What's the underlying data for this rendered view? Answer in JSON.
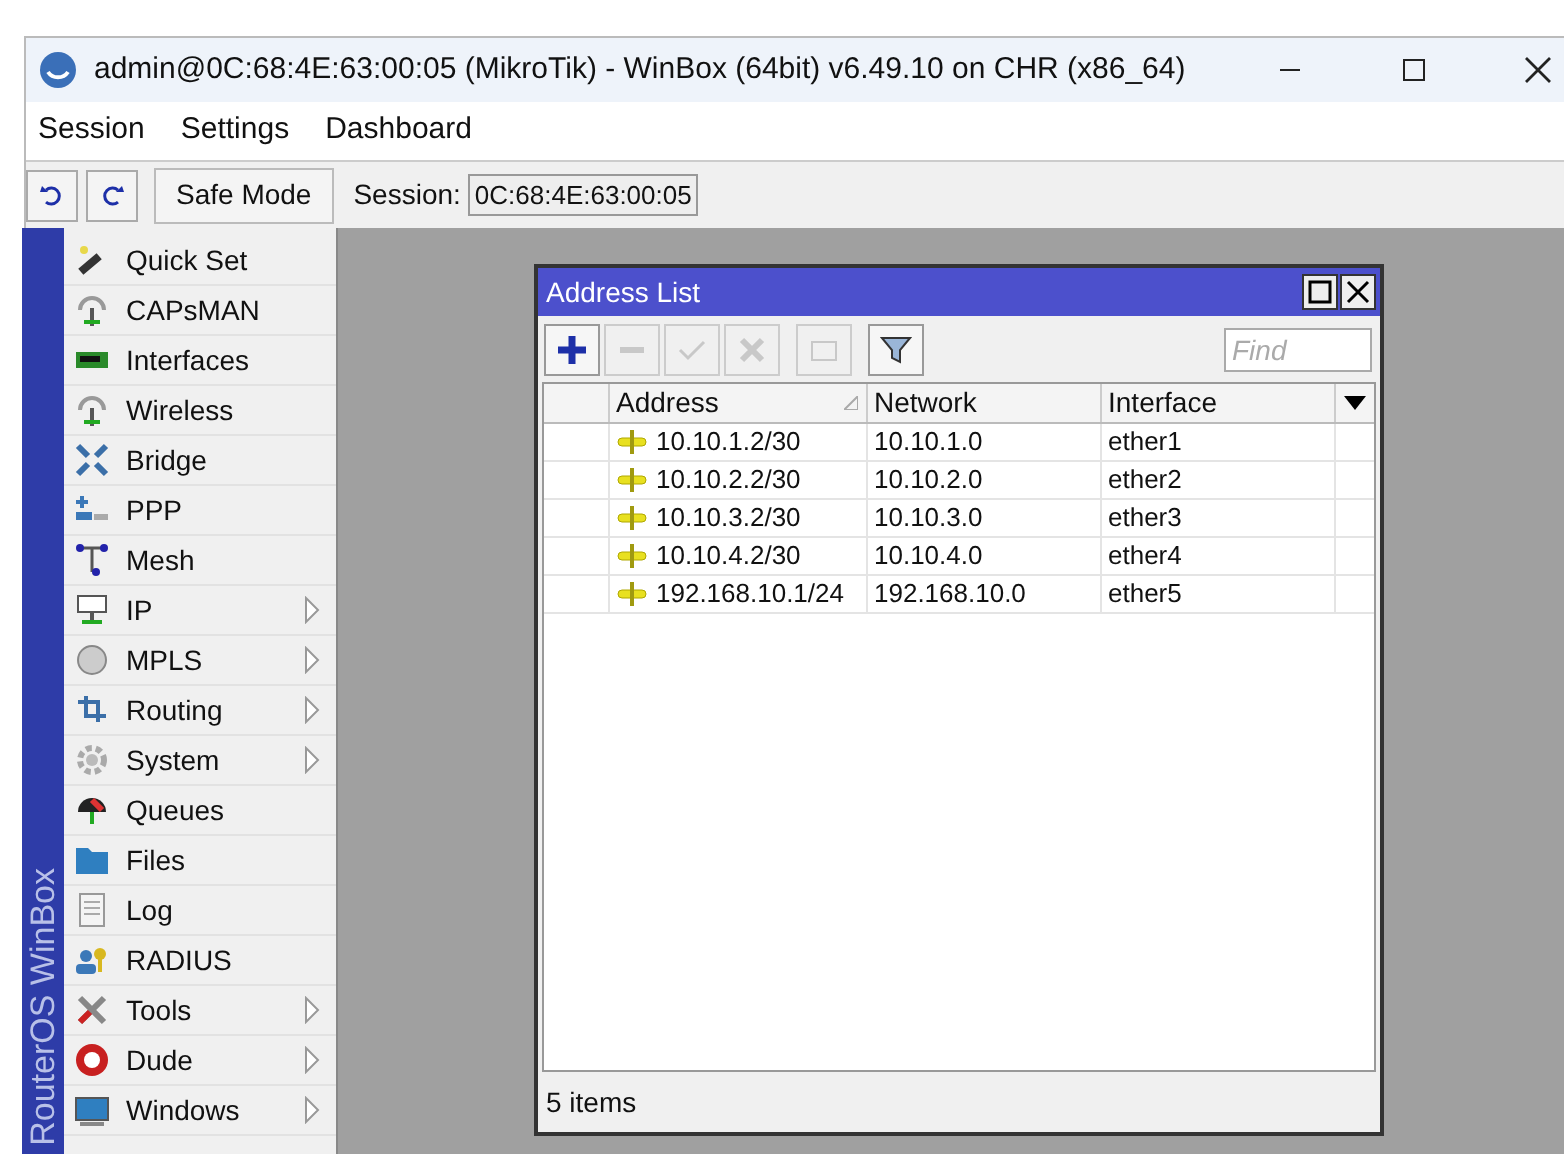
{
  "window": {
    "title": "admin@0C:68:4E:63:00:05 (MikroTik) - WinBox (64bit) v6.49.10 on CHR (x86_64)"
  },
  "menu": [
    "Session",
    "Settings",
    "Dashboard"
  ],
  "toolbar": {
    "safe_mode": "Safe Mode",
    "session_label": "Session:",
    "session_value": "0C:68:4E:63:00:05"
  },
  "sidebar": {
    "brand": "RouterOS WinBox",
    "items": [
      {
        "label": "Quick Set",
        "submenu": false
      },
      {
        "label": "CAPsMAN",
        "submenu": false
      },
      {
        "label": "Interfaces",
        "submenu": false
      },
      {
        "label": "Wireless",
        "submenu": false
      },
      {
        "label": "Bridge",
        "submenu": false
      },
      {
        "label": "PPP",
        "submenu": false
      },
      {
        "label": "Mesh",
        "submenu": false
      },
      {
        "label": "IP",
        "submenu": true
      },
      {
        "label": "MPLS",
        "submenu": true
      },
      {
        "label": "Routing",
        "submenu": true
      },
      {
        "label": "System",
        "submenu": true
      },
      {
        "label": "Queues",
        "submenu": false
      },
      {
        "label": "Files",
        "submenu": false
      },
      {
        "label": "Log",
        "submenu": false
      },
      {
        "label": "RADIUS",
        "submenu": false
      },
      {
        "label": "Tools",
        "submenu": true
      },
      {
        "label": "Dude",
        "submenu": true
      },
      {
        "label": "Windows",
        "submenu": true
      }
    ]
  },
  "address_list": {
    "title": "Address List",
    "tools": [
      {
        "disabled": false
      },
      {
        "disabled": true
      },
      {
        "disabled": true
      },
      {
        "disabled": true
      },
      {
        "disabled": true
      },
      {
        "disabled": false
      }
    ],
    "find_placeholder": "Find",
    "columns": [
      "Address",
      "Network",
      "Interface"
    ],
    "rows": [
      {
        "address": "10.10.1.2/30",
        "network": "10.10.1.0",
        "interface": "ether1"
      },
      {
        "address": "10.10.2.2/30",
        "network": "10.10.2.0",
        "interface": "ether2"
      },
      {
        "address": "10.10.3.2/30",
        "network": "10.10.3.0",
        "interface": "ether3"
      },
      {
        "address": "10.10.4.2/30",
        "network": "10.10.4.0",
        "interface": "ether4"
      },
      {
        "address": "192.168.10.1/24",
        "network": "192.168.10.0",
        "interface": "ether5"
      }
    ],
    "status": "5 items"
  }
}
